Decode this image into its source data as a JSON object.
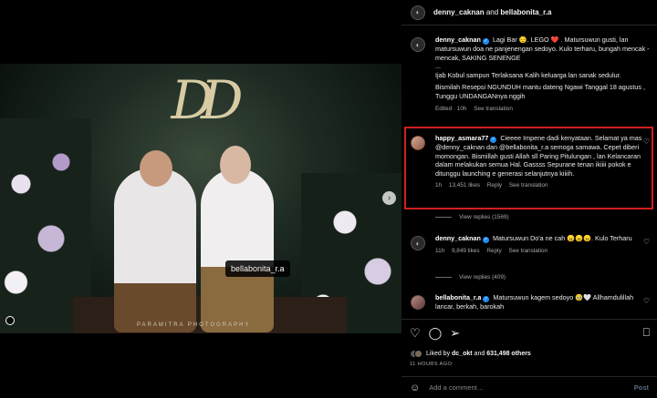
{
  "post": {
    "header_user1": "denny_caknan",
    "header_and": "and",
    "header_user2": "bellabonita_r.a",
    "photo_credit": "PARAMITRA PHOTOGRAPHY",
    "tag_label": "bellabonita_r.a"
  },
  "caption": {
    "user": "denny_caknan",
    "line1": "Lagi Bar 😌. LEGO ❤️ . Matursuwun gusti, lan matursuwun doa ne panjenengan sedoyo. Kulo terharu, bungah mencak - mencak, SAKING SENENGE",
    "line2": "...",
    "line3": "Ijab Kobul sampun Terlaksana Kalih keluarga lan sanak sedulur.",
    "line4": "Bismilah Resepsi NGUNDUH mantu dateng Ngawi Tanggal 18 agustus , Tunggu UNDANGANnya nggih",
    "meta_edited": "Edited · 10h",
    "meta_translate": "See translation"
  },
  "comment1": {
    "user": "happy_asmara77",
    "text": "Cieeee Impene dadi kenyataan. Selamat ya mas @denny_caknan dan @bellabonita_r.a semoga samawa. Cepet diberi momongan. Bismillah gusti Allah sll Paring Pitulungan , lan Kelancaran dalam melakukan semua Hal. Gassss Sepurane tenan ikiiii pokok e ditunggu launching e generasi selanjutnya kiiiih.",
    "time": "1h",
    "likes": "13,451 likes",
    "reply": "Reply",
    "translate": "See translation",
    "view_replies": "View replies (1569)"
  },
  "comment2": {
    "user": "denny_caknan",
    "text": "Matursuwun Do'a ne cah 😠😠😠. Kulo Terharu",
    "time": "11h",
    "likes": "9,849 likes",
    "reply": "Reply",
    "translate": "See translation",
    "view_replies": "View replies (409)"
  },
  "comment3": {
    "user": "bellabonita_r.a",
    "text": "Matursuwun kagem sedoyo 🥹🤍 Allhamdulillah lancar, berkah, barokah"
  },
  "actions": {
    "liked_by_prefix": "Liked by",
    "liked_by_user": "dc_okt",
    "liked_by_and": "and",
    "liked_by_count": "631,498 others",
    "time_ago": "11 HOURS AGO",
    "add_comment_placeholder": "Add a comment…",
    "post_label": "Post"
  },
  "colors": {
    "highlight": "#d11f1f",
    "verified": "#1d8cf5",
    "post_button": "#5a6b80"
  }
}
